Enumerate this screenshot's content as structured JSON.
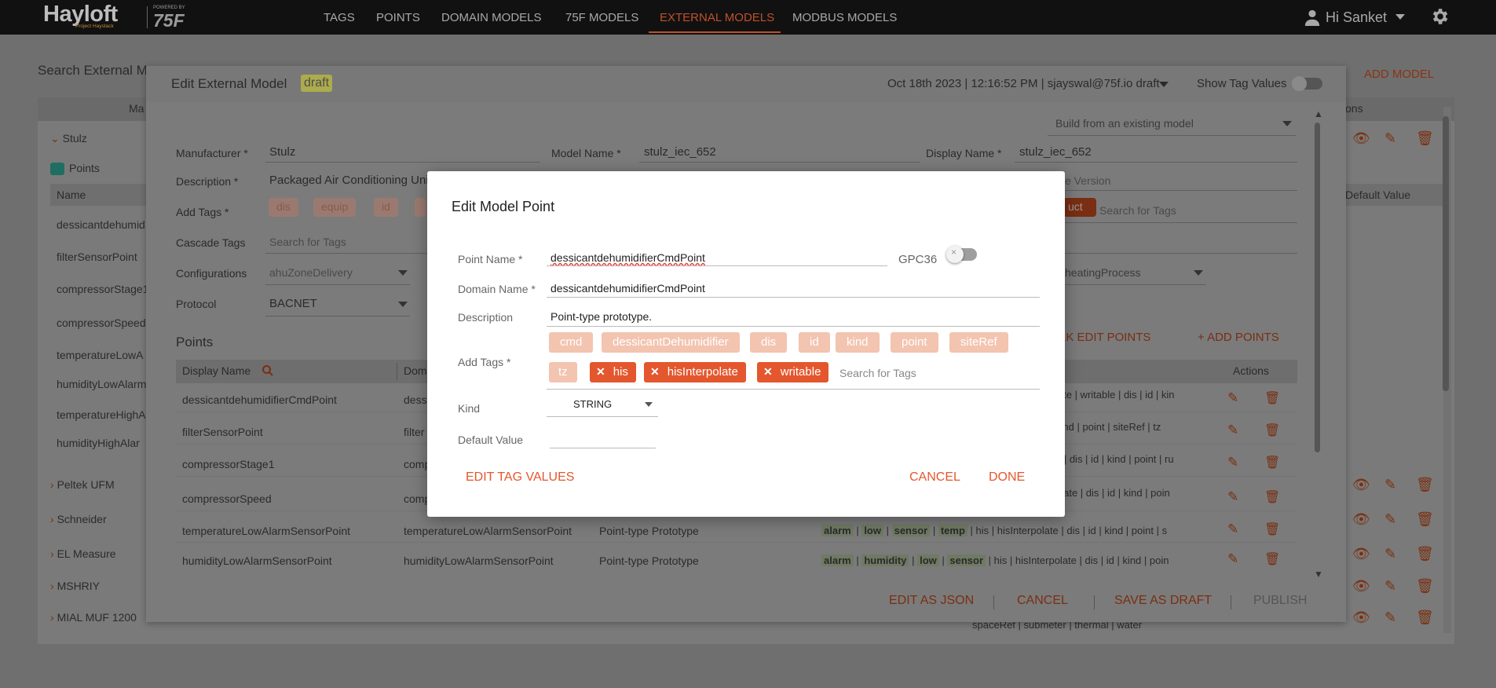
{
  "nav": {
    "logo": "Hayloft",
    "logo_sub": "Project Haystack",
    "powered_by": "POWERED BY",
    "brand": "75F",
    "links": [
      "TAGS",
      "POINTS",
      "DOMAIN MODELS",
      "75F MODELS",
      "EXTERNAL MODELS",
      "MODBUS MODELS"
    ],
    "active_link": "EXTERNAL MODELS",
    "user_label": "Hi Sanket"
  },
  "background": {
    "search_label": "Search External M",
    "add_model": "ADD MODEL",
    "col_manufacturer": "Ma",
    "col_actions": "ons",
    "manufacturers": [
      "Stulz",
      "Peltek UFM",
      "Schneider",
      "EL Measure",
      "MSHRIY",
      "MIAL MUF 1200"
    ],
    "points_label": "Points",
    "name_col": "Name",
    "default_value_col": "Default Value",
    "bg_points": [
      "dessicantdehumid",
      "filterSensorPoint",
      "compressorStage1",
      "compressorSpeed",
      "temperatureLowA",
      "humidityLowAlarm",
      "temperatureHighA",
      "humidityHighAlar"
    ],
    "bottom_tags": "spaceRef | submeter | thermal | water"
  },
  "edit_panel": {
    "title": "Edit External Model",
    "status": "draft",
    "meta": "Oct 18th 2023 | 12:16:52 PM | sjayswal@75f.io draft",
    "show_tag_values": "Show Tag Values",
    "build_from": "Build from an existing model",
    "manufacturer_label": "Manufacturer *",
    "manufacturer_value": "Stulz",
    "model_name_label": "Model Name *",
    "model_name_value": "stulz_iec_652",
    "display_name_label": "Display Name *",
    "display_name_value": "stulz_iec_652",
    "description_label": "Description *",
    "description_value": "Packaged Air Conditioning Uni",
    "version_label": "e Version",
    "add_tags_label": "Add Tags *",
    "tags": [
      "dis",
      "equip",
      "id"
    ],
    "tag_right": "uct",
    "search_tags": "Search for Tags",
    "cascade_label": "Cascade Tags",
    "cascade_placeholder": "Search for Tags",
    "config_label": "Configurations",
    "config_value": "ahuZoneDelivery",
    "config_right": "heatingProcess",
    "protocol_label": "Protocol",
    "protocol_value": "BACNET",
    "points_heading": "Points",
    "bulk_edit": "LK EDIT POINTS",
    "add_points": "+ ADD POINTS",
    "col_display_name": "Display Name",
    "col_domain": "Dom",
    "col_actions": "Actions",
    "rows": [
      {
        "name": "dessicantdehumidifierCmdPoint",
        "domain": "dessi",
        "desc": "",
        "tags": "late | writable | dis | id | kin"
      },
      {
        "name": "filterSensorPoint",
        "domain": "filter",
        "desc": "",
        "tags": "kind | point | siteRef | tz"
      },
      {
        "name": "compressorStage1",
        "domain": "comp",
        "desc": "",
        "tags": "e | dis | id | kind | point | ru"
      },
      {
        "name": "compressorSpeed",
        "domain": "comp",
        "desc": "",
        "tags": "olate | dis | id | kind | poin"
      },
      {
        "name": "temperatureLowAlarmSensorPoint",
        "domain": "temperatureLowAlarmSensorPoint",
        "desc": "Point-type Prototype",
        "tags": "his | hisInterpolate | dis | id | kind | point | s",
        "hl": [
          "alarm",
          "low",
          "sensor",
          "temp"
        ]
      },
      {
        "name": "humidityLowAlarmSensorPoint",
        "domain": "humidityLowAlarmSensorPoint",
        "desc": "Point-type Prototype",
        "tags": "his | hisInterpolate | dis | id | kind | poin",
        "hl": [
          "alarm",
          "humidity",
          "low",
          "sensor"
        ]
      }
    ],
    "footer": {
      "edit_json": "EDIT AS JSON",
      "cancel": "CANCEL",
      "save_draft": "SAVE AS DRAFT",
      "publish": "PUBLISH"
    }
  },
  "modal": {
    "title": "Edit Model Point",
    "point_name_label": "Point Name *",
    "point_name_value": "dessicantdehumidifierCmdPoint",
    "gpc36_label": "GPC36",
    "domain_name_label": "Domain Name *",
    "domain_name_value": "dessicantdehumidifierCmdPoint",
    "description_label": "Description",
    "description_value": "Point-type prototype.",
    "add_tags_label": "Add Tags *",
    "tags": [
      "cmd",
      "dessicantDehumidifier",
      "dis",
      "id",
      "kind",
      "point",
      "siteRef",
      "tz"
    ],
    "active_tags": [
      "his",
      "hisInterpolate",
      "writable"
    ],
    "search_placeholder": "Search for Tags",
    "kind_label": "Kind",
    "kind_value": "STRING",
    "default_value_label": "Default Value",
    "default_value_value": "",
    "edit_tag_values": "EDIT TAG VALUES",
    "cancel": "CANCEL",
    "done": "DONE"
  },
  "colors": {
    "accent": "#e4572e",
    "tag_light": "#f3c4b0",
    "nav_bg": "#111111"
  }
}
